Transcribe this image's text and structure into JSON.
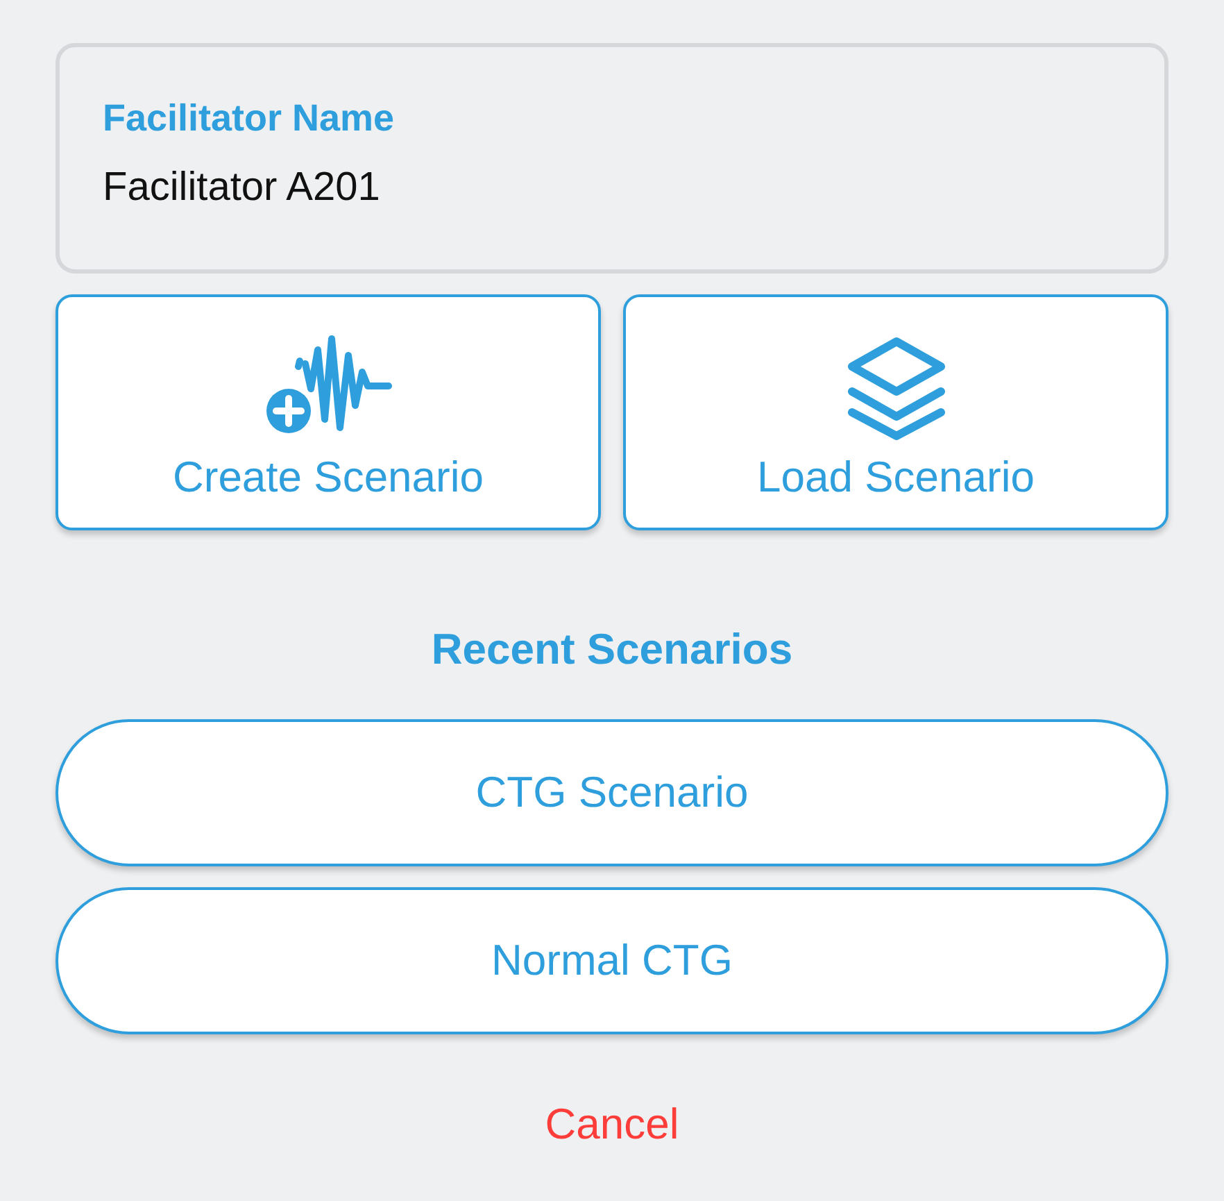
{
  "name_field": {
    "label": "Facilitator Name",
    "value": "Facilitator A201"
  },
  "actions": [
    {
      "label": "Create Scenario",
      "kind": "create"
    },
    {
      "label": "Load Scenario",
      "kind": "load"
    }
  ],
  "recent_title": "Recent Scenarios",
  "recent": [
    {
      "label": "CTG Scenario"
    },
    {
      "label": "Normal CTG"
    }
  ],
  "cancel": "Cancel"
}
